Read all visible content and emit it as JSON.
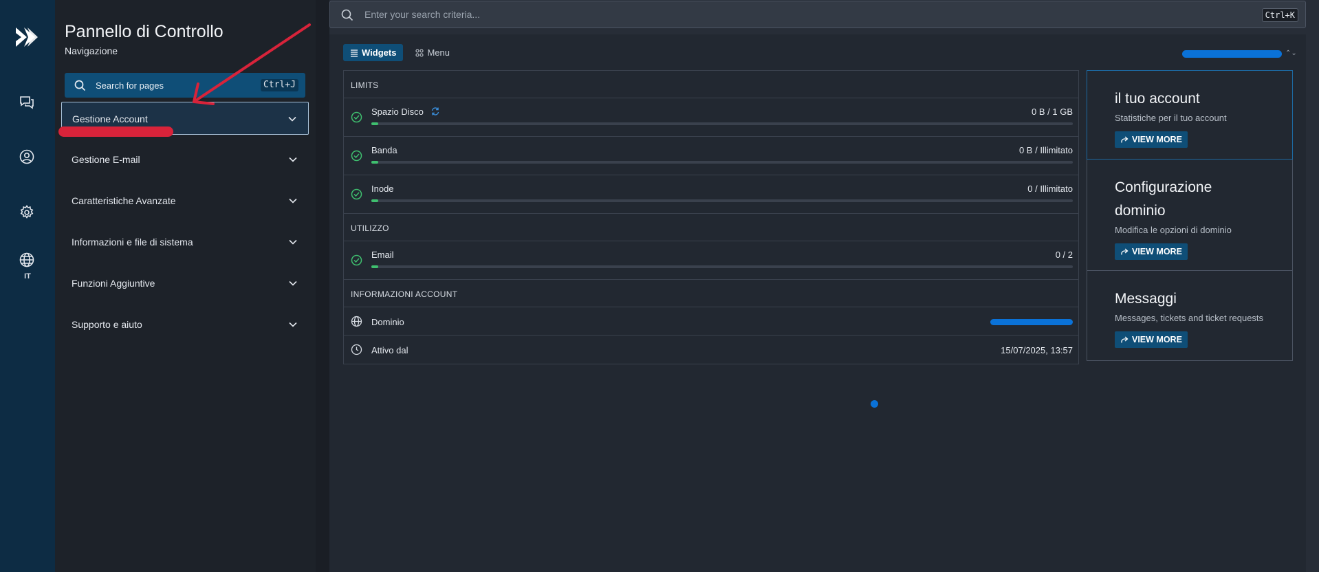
{
  "nav": {
    "title": "Pannello di Controllo",
    "subtitle": "Navigazione",
    "search_label": "Search for pages",
    "search_shortcut": "Ctrl+J",
    "items": [
      {
        "label": "Gestione Account",
        "active": true
      },
      {
        "label": "Gestione E-mail"
      },
      {
        "label": "Caratteristiche Avanzate"
      },
      {
        "label": "Informazioni e file di sistema"
      },
      {
        "label": "Funzioni Aggiuntive"
      },
      {
        "label": "Supporto e aiuto"
      }
    ]
  },
  "rail": {
    "language": "IT",
    "icons": [
      "logo-icon",
      "chat-icon",
      "user-icon",
      "gear-icon",
      "globe-icon"
    ]
  },
  "top_search": {
    "placeholder": "Enter your search criteria...",
    "shortcut": "Ctrl+K"
  },
  "tabs": [
    {
      "label": "Widgets",
      "active": true
    },
    {
      "label": "Menu",
      "active": false
    }
  ],
  "limits": {
    "header": "LIMITS",
    "rows": [
      {
        "label": "Spazio Disco",
        "value": "0 B / 1 GB",
        "progress": 0.01
      },
      {
        "label": "Banda",
        "value": "0 B / Illimitato",
        "progress": 0.01
      },
      {
        "label": "Inode",
        "value": "0 / Illimitato",
        "progress": 0.01
      }
    ]
  },
  "usage": {
    "header": "UTILIZZO",
    "rows": [
      {
        "label": "Email",
        "value": "0 / 2",
        "progress": 0.01
      }
    ]
  },
  "account_info": {
    "header": "INFORMAZIONI ACCOUNT",
    "domain_label": "Dominio",
    "active_since_label": "Attivo dal",
    "active_since_value": "15/07/2025, 13:57"
  },
  "cards": [
    {
      "title": "il tuo account",
      "desc": "Statistiche per il tuo account",
      "button": "VIEW MORE"
    },
    {
      "title": "Configurazione dominio",
      "desc": "Modifica le opzioni di dominio",
      "button": "VIEW MORE"
    },
    {
      "title": "Messaggi",
      "desc": "Messages, tickets and ticket requests",
      "button": "VIEW MORE"
    }
  ],
  "colors": {
    "accent": "#0f4e77",
    "rail": "#0d2c44",
    "success": "#3fbf6f",
    "annotation_red": "#d8233a",
    "redaction_blue": "#0a72d8"
  }
}
